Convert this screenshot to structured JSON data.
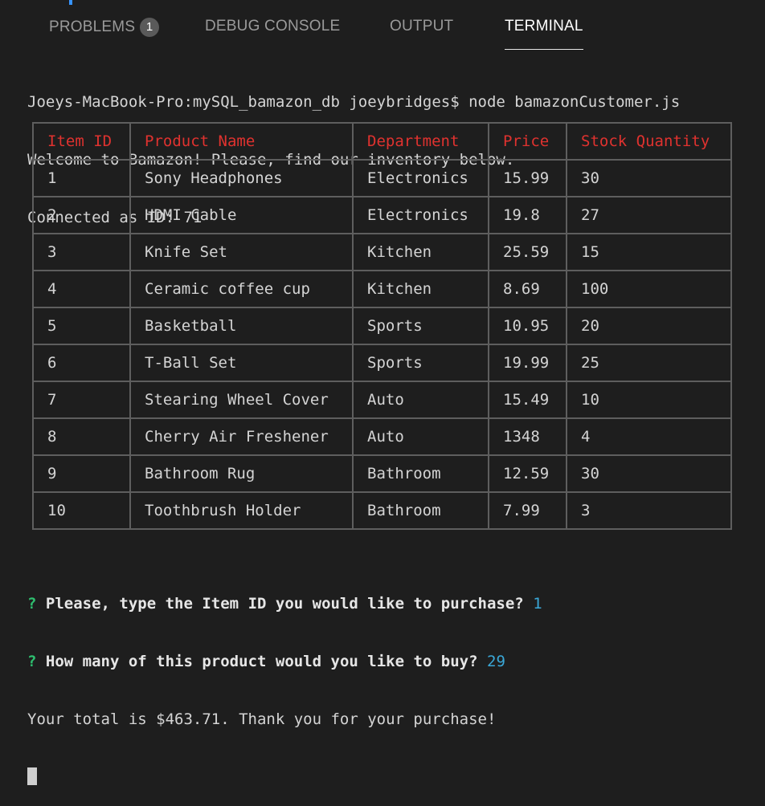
{
  "tabs": [
    {
      "label": "PROBLEMS",
      "badge": "1",
      "active": false
    },
    {
      "label": "DEBUG CONSOLE",
      "active": false
    },
    {
      "label": "OUTPUT",
      "active": false
    },
    {
      "label": "TERMINAL",
      "active": true
    }
  ],
  "terminal": {
    "lines": [
      "Joeys-MacBook-Pro:mySQL_bamazon_db joeybridges$ node bamazonCustomer.js",
      "Welcome to Bamazon! Please, find our inventory below.",
      "Connected as ID: 71"
    ],
    "table": {
      "headers": [
        "Item ID",
        "Product Name",
        "Department",
        "Price",
        "Stock Quantity"
      ],
      "rows": [
        [
          "1",
          "Sony Headphones",
          "Electronics",
          "15.99",
          "30"
        ],
        [
          "2",
          "HDMI Cable",
          "Electronics",
          "19.8",
          "27"
        ],
        [
          "3",
          "Knife Set",
          "Kitchen",
          "25.59",
          "15"
        ],
        [
          "4",
          "Ceramic coffee cup",
          "Kitchen",
          "8.69",
          "100"
        ],
        [
          "5",
          "Basketball",
          "Sports",
          "10.95",
          "20"
        ],
        [
          "6",
          "T-Ball Set",
          "Sports",
          "19.99",
          "25"
        ],
        [
          "7",
          "Stearing Wheel Cover",
          "Auto",
          "15.49",
          "10"
        ],
        [
          "8",
          "Cherry Air Freshener",
          "Auto",
          "1348",
          "4"
        ],
        [
          "9",
          "Bathroom Rug",
          "Bathroom",
          "12.59",
          "30"
        ],
        [
          "10",
          "Toothbrush Holder",
          "Bathroom",
          "7.99",
          "3"
        ]
      ]
    },
    "prompts": [
      {
        "mark": "?",
        "question": "Please, type the Item ID you would like to purchase?",
        "answer": "1"
      },
      {
        "mark": "?",
        "question": "How many of this product would you like to buy?",
        "answer": "29"
      }
    ],
    "result": "Your total is $463.71. Thank you for your purchase!"
  },
  "colors": {
    "background": "#1e1e1e",
    "header_text": "#e0322f",
    "prompt_mark": "#2ebf6f",
    "answer_text": "#3aa8d8",
    "badge": "#5a5a5a"
  }
}
